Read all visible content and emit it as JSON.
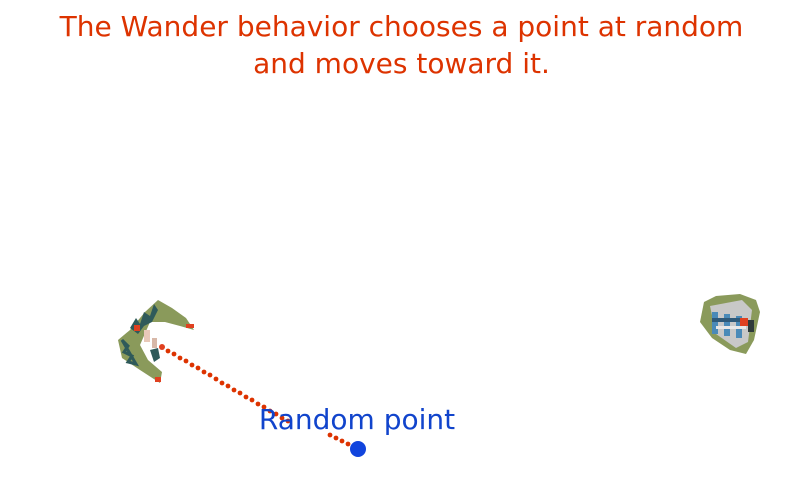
{
  "caption": {
    "line1": "The Wander behavior chooses a point at random",
    "line2": "and moves toward it."
  },
  "random_point": {
    "label": "Random point"
  },
  "colors": {
    "caption": "#dd3300",
    "label": "#1144cc",
    "path": "#dd3300",
    "point": "#1144dd",
    "ship_hull": "#8a9a5b",
    "ship_dark": "#2f5a5a",
    "ship_accent": "#e04020",
    "ship2_blue": "#4a8ab8"
  },
  "icons": {
    "wanderer": "wanderer-ship-icon",
    "other": "other-ship-icon"
  }
}
